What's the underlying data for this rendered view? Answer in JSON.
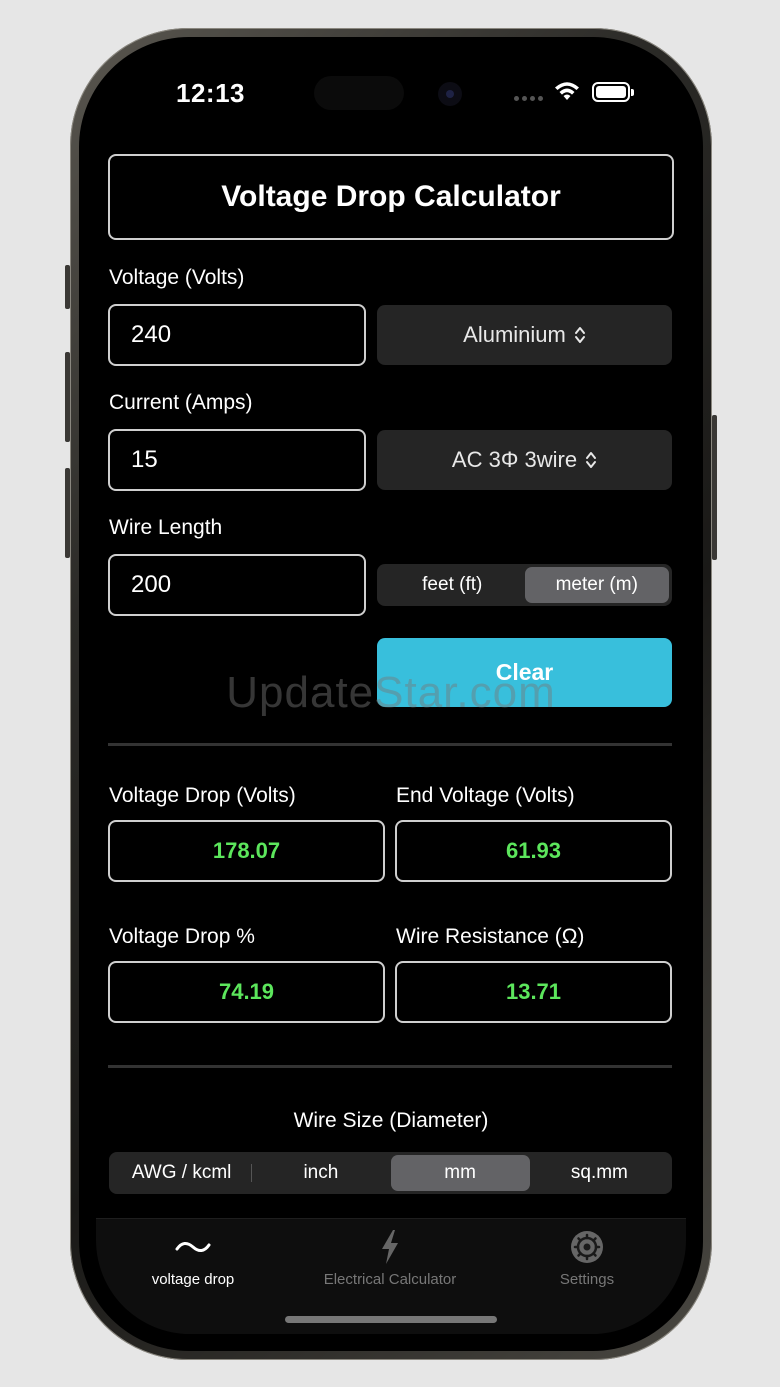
{
  "status": {
    "time": "12:13"
  },
  "title": "Voltage Drop Calculator",
  "inputs": {
    "voltage": {
      "label": "Voltage (Volts)",
      "value": "240"
    },
    "current": {
      "label": "Current (Amps)",
      "value": "15"
    },
    "length": {
      "label": "Wire Length",
      "value": "200"
    }
  },
  "pickers": {
    "material": "Aluminium",
    "phase": "AC 3Φ 3wire"
  },
  "length_unit": {
    "options": [
      "feet (ft)",
      "meter (m)"
    ],
    "selected": "meter (m)"
  },
  "clear_label": "Clear",
  "watermark": "UpdateStar.com",
  "results": {
    "voltage_drop": {
      "label": "Voltage Drop (Volts)",
      "value": "178.07"
    },
    "end_voltage": {
      "label": "End Voltage (Volts)",
      "value": "61.93"
    },
    "drop_percent": {
      "label": "Voltage Drop %",
      "value": "74.19"
    },
    "resistance": {
      "label": "Wire Resistance (Ω)",
      "value": "13.71"
    }
  },
  "wire_size": {
    "label": "Wire Size (Diameter)",
    "options": [
      "AWG / kcml",
      "inch",
      "mm",
      "sq.mm"
    ],
    "selected": "mm"
  },
  "tabs": [
    {
      "label": "voltage drop",
      "icon": "wave-icon",
      "active": true
    },
    {
      "label": "Electrical Calculator",
      "icon": "bolt-icon",
      "active": false
    },
    {
      "label": "Settings",
      "icon": "gear-icon",
      "active": false
    }
  ],
  "colors": {
    "result_green": "#5ce65c",
    "clear_accent": "#38bfdc"
  }
}
